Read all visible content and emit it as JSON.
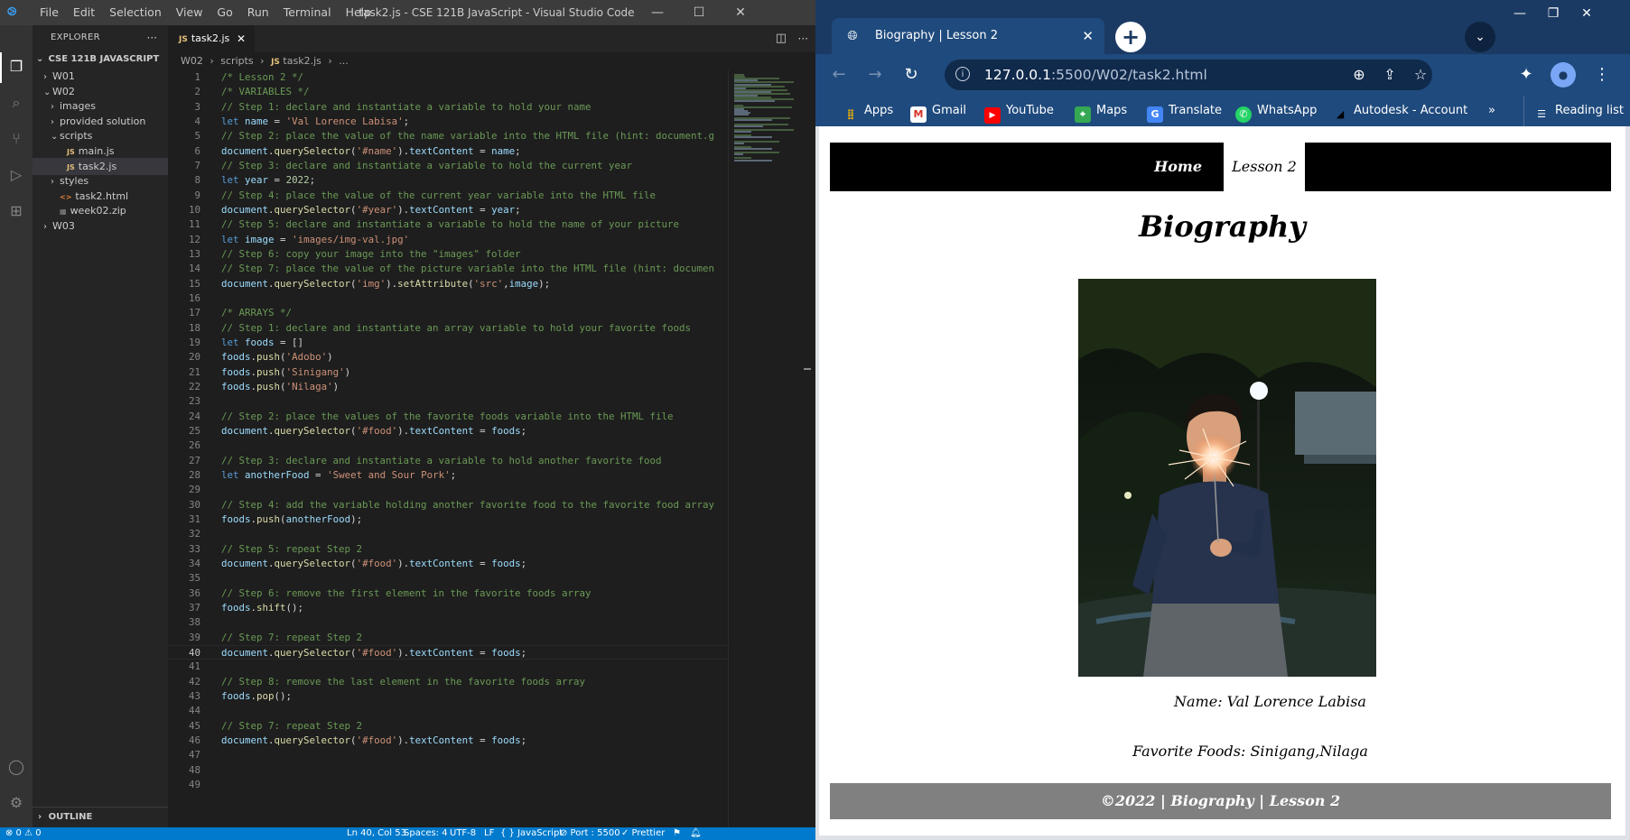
{
  "vscode": {
    "menu": [
      "File",
      "Edit",
      "Selection",
      "View",
      "Go",
      "Run",
      "Terminal",
      "Help"
    ],
    "window_title": "task2.js - CSE 121B JavaScript - Visual Studio Code",
    "explorer_header": "EXPLORER",
    "workspace": "CSE 121B JAVASCRIPT",
    "tree": [
      {
        "label": "W01",
        "chev": "›",
        "indent": 1
      },
      {
        "label": "W02",
        "chev": "⌄",
        "indent": 1
      },
      {
        "label": "images",
        "chev": "›",
        "indent": 2
      },
      {
        "label": "provided solution",
        "chev": "›",
        "indent": 2
      },
      {
        "label": "scripts",
        "chev": "⌄",
        "indent": 2
      },
      {
        "label": "main.js",
        "chev": "",
        "indent": 3,
        "icon": "JS"
      },
      {
        "label": "task2.js",
        "chev": "",
        "indent": 3,
        "icon": "JS",
        "selected": true
      },
      {
        "label": "styles",
        "chev": "›",
        "indent": 2
      },
      {
        "label": "task2.html",
        "chev": "",
        "indent": 2,
        "icon": "<>"
      },
      {
        "label": "week02.zip",
        "chev": "",
        "indent": 2,
        "icon": "▦"
      },
      {
        "label": "W03",
        "chev": "›",
        "indent": 1
      }
    ],
    "outline_label": "OUTLINE",
    "tab": {
      "label": "task2.js",
      "icon": "JS"
    },
    "breadcrumb": [
      "W02",
      "scripts",
      "task2.js",
      "..."
    ],
    "current_line": 40,
    "code_lines": [
      "/* Lesson 2 */",
      "/* VARIABLES */",
      "// Step 1: declare and instantiate a variable to hold your name",
      "let name = 'Val Lorence Labisa';",
      "// Step 2: place the value of the name variable into the HTML file (hint: document.g",
      "document.querySelector('#name').textContent = name;",
      "// Step 3: declare and instantiate a variable to hold the current year",
      "let year = 2022;",
      "// Step 4: place the value of the current year variable into the HTML file",
      "document.querySelector('#year').textContent = year;",
      "// Step 5: declare and instantiate a variable to hold the name of your picture",
      "let image = 'images/img-val.jpg'",
      "// Step 6: copy your image into the \"images\" folder",
      "// Step 7: place the value of the picture variable into the HTML file (hint: documen",
      "document.querySelector('img').setAttribute('src',image);",
      "",
      "/* ARRAYS */",
      "// Step 1: declare and instantiate an array variable to hold your favorite foods",
      "let foods = []",
      "foods.push('Adobo')",
      "foods.push('Sinigang')",
      "foods.push('Nilaga')",
      "",
      "// Step 2: place the values of the favorite foods variable into the HTML file",
      "document.querySelector('#food').textContent = foods;",
      "",
      "// Step 3: declare and instantiate a variable to hold another favorite food",
      "let anotherFood = 'Sweet and Sour Pork';",
      "",
      "// Step 4: add the variable holding another favorite food to the favorite food array",
      "foods.push(anotherFood);",
      "",
      "// Step 5: repeat Step 2",
      "document.querySelector('#food').textContent = foods;",
      "",
      "// Step 6: remove the first element in the favorite foods array",
      "foods.shift();",
      "",
      "// Step 7: repeat Step 2",
      "document.querySelector('#food').textContent = foods;",
      "",
      "// Step 8: remove the last element in the favorite foods array",
      "foods.pop();",
      "",
      "// Step 7: repeat Step 2",
      "document.querySelector('#food').textContent = foods;",
      "",
      "",
      ""
    ],
    "status": {
      "problems": "⊗ 0 ⚠ 0",
      "position": "Ln 40, Col 53",
      "spaces": "Spaces: 4",
      "encoding": "UTF-8",
      "eol": "LF",
      "language": "{ } JavaScript",
      "port": "⊘ Port : 5500",
      "prettier": "✓ Prettier"
    },
    "colors": {
      "comment": "#6a9955",
      "keyword": "#569cd6",
      "string": "#ce9178",
      "variable": "#9cdcfe",
      "function": "#dcdcaa",
      "number": "#b5cea8",
      "statusbar": "#007acc"
    }
  },
  "chrome": {
    "tab_title": "Biography | Lesson 2",
    "url_host": "127.0.0.1",
    "url_rest": ":5500/W02/task2.html",
    "bookmarks": [
      "Apps",
      "Gmail",
      "YouTube",
      "Maps",
      "Translate",
      "WhatsApp",
      "Autodesk - Account"
    ],
    "overflow": "»",
    "reading_list": "Reading list"
  },
  "page": {
    "nav_home": "Home",
    "nav_lesson": "Lesson 2",
    "title": "Biography",
    "name_line": "Name: Val Lorence Labisa",
    "foods_line": "Favorite Foods: Sinigang,Nilaga",
    "footer": "©2022 | Biography | Lesson 2"
  }
}
